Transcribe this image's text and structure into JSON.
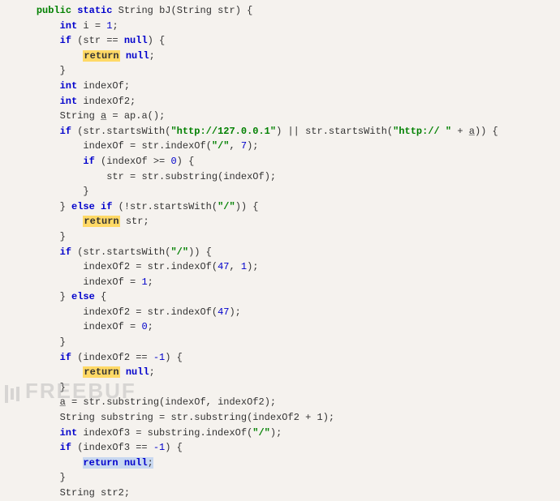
{
  "code": {
    "method_sig": {
      "public": "public",
      "static": "static",
      "ret_type": "String",
      "name": "bJ",
      "param_type": "String",
      "param_name": "str"
    },
    "line_int_i": {
      "type": "int",
      "name": "i",
      "val": "1"
    },
    "line_if_null": {
      "kw": "if",
      "cond_var": "str",
      "op": "==",
      "null": "null"
    },
    "line_ret_null1": {
      "kw": "return",
      "val": "null"
    },
    "line_int_indexof": {
      "type": "int",
      "name": "indexOf"
    },
    "line_int_indexof2": {
      "type": "int",
      "name": "indexOf2"
    },
    "line_string_a": {
      "type": "String",
      "name": "a",
      "expr": "ap.a()"
    },
    "line_if_starts": {
      "kw": "if",
      "var": "str",
      "method": "startsWith",
      "arg1": "\"http://127.0.0.1\"",
      "op": "||",
      "arg2": "\"http:// \"",
      "plus_var": "a"
    },
    "line_indexof_assign": {
      "lhs": "indexOf",
      "var": "str",
      "method": "indexOf",
      "arg1": "\"/\"",
      "arg2": "7"
    },
    "line_if_indexof_ge": {
      "kw": "if",
      "var": "indexOf",
      "op": ">=",
      "val": "0"
    },
    "line_str_substr": {
      "lhs": "str",
      "var": "str",
      "method": "substring",
      "arg": "indexOf"
    },
    "line_elseif_not_starts": {
      "kw_else": "else",
      "kw_if": "if",
      "not": "!",
      "var": "str",
      "method": "startsWith",
      "arg": "\"/\""
    },
    "line_ret_str": {
      "kw": "return",
      "val": "str"
    },
    "line_if_starts_slash": {
      "kw": "if",
      "var": "str",
      "method": "startsWith",
      "arg": "\"/\""
    },
    "line_indexof2_a": {
      "lhs": "indexOf2",
      "var": "str",
      "method": "indexOf",
      "arg1": "47",
      "arg2": "1"
    },
    "line_indexof_1": {
      "lhs": "indexOf",
      "val": "1"
    },
    "line_else": {
      "kw": "else"
    },
    "line_indexof2_b": {
      "lhs": "indexOf2",
      "var": "str",
      "method": "indexOf",
      "arg": "47"
    },
    "line_indexof_0": {
      "lhs": "indexOf",
      "val": "0"
    },
    "line_if_indexof2_neg1": {
      "kw": "if",
      "var": "indexOf2",
      "op": "==",
      "val": "-1"
    },
    "line_ret_null2": {
      "kw": "return",
      "val": "null"
    },
    "line_a_substr": {
      "lhs": "a",
      "var": "str",
      "method": "substring",
      "arg1": "indexOf",
      "arg2": "indexOf2"
    },
    "line_substring_decl": {
      "type": "String",
      "name": "substring",
      "var": "str",
      "method": "substring",
      "arg": "indexOf2 + 1"
    },
    "line_indexof3_decl": {
      "type": "int",
      "name": "indexOf3",
      "var": "substring",
      "method": "indexOf",
      "arg": "\"/\""
    },
    "line_if_indexof3_neg1": {
      "kw": "if",
      "var": "indexOf3",
      "op": "==",
      "val": "-1"
    },
    "line_ret_null3": {
      "kw": "return",
      "val": "null"
    },
    "line_str2_decl": {
      "type": "String",
      "name": "str2"
    }
  },
  "watermark": "FREEBUF"
}
